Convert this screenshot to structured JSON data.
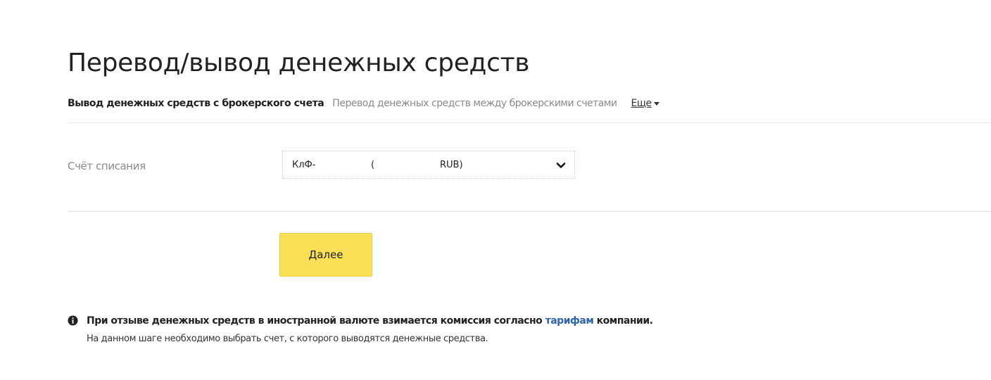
{
  "page": {
    "title": "Перевод/вывод денежных средств"
  },
  "tabs": {
    "active": "Вывод денежных средств с брокерского счета",
    "secondary": "Перевод денежных средств между брокерскими счетами",
    "more": "Еще"
  },
  "form": {
    "account_label": "Счёт списания",
    "account_select": {
      "part1": "КлФ-",
      "part2": "(",
      "part3": "RUB)"
    },
    "next_button": "Далее"
  },
  "info": {
    "line1_before": "При отзыве денежных средств в иностранной валюте взимается комиссия согласно ",
    "link": "тарифам",
    "line1_after": " компании.",
    "line2": "На данном шаге необходимо выбрать счет, с которого выводятся денежные средства."
  },
  "colors": {
    "accent_button": "#f9df55",
    "link": "#2e63a8",
    "muted_text": "#8a8a8a"
  },
  "icons": {
    "tab_more": "caret-down-icon",
    "select": "chevron-down-icon",
    "info": "info-circle-icon"
  }
}
